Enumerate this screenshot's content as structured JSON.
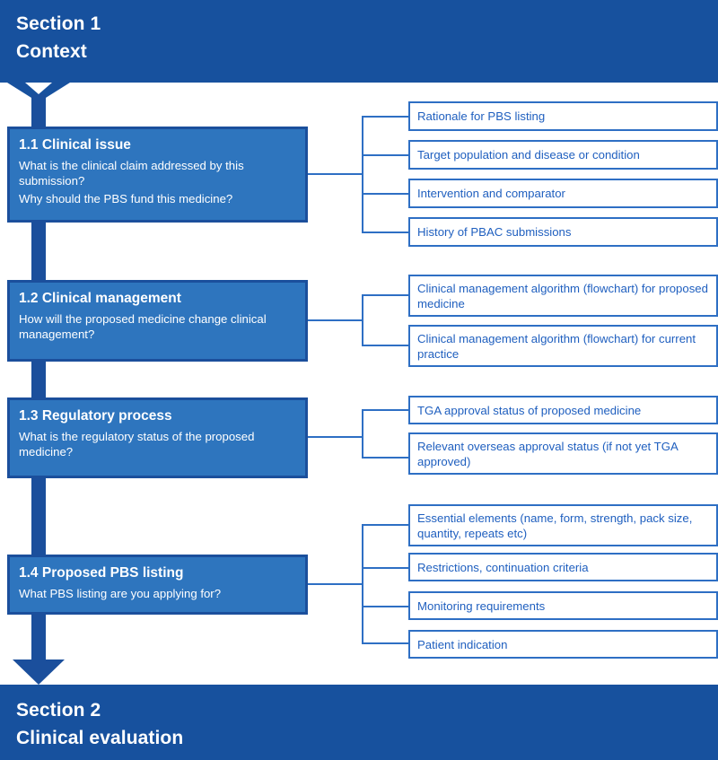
{
  "top_section": {
    "label": "Section 1",
    "name": "Context"
  },
  "bottom_section": {
    "label": "Section 2",
    "name": "Clinical evaluation"
  },
  "groups": [
    {
      "id": "1.1",
      "title": "1.1 Clinical issue",
      "questions": [
        "What is the clinical claim addressed by this submission?",
        "Why should the PBS fund this medicine?"
      ],
      "items": [
        "Rationale for PBS listing",
        "Target population and disease or condition",
        "Intervention and comparator",
        "History of PBAC submissions"
      ]
    },
    {
      "id": "1.2",
      "title": "1.2 Clinical management",
      "questions": [
        "How will the proposed medicine change clinical management?"
      ],
      "items": [
        "Clinical management algorithm (flowchart) for proposed medicine",
        "Clinical management algorithm (flowchart) for current practice"
      ]
    },
    {
      "id": "1.3",
      "title": "1.3 Regulatory process",
      "questions": [
        "What is the regulatory status of the proposed medicine?"
      ],
      "items": [
        "TGA approval status of proposed medicine",
        "Relevant overseas approval status (if not yet TGA approved)"
      ]
    },
    {
      "id": "1.4",
      "title": "1.4 Proposed PBS listing",
      "questions": [
        "What PBS listing are you applying for?"
      ],
      "items": [
        "Essential elements (name, form, strength, pack size, quantity, repeats etc)",
        "Restrictions, continuation criteria",
        "Monitoring requirements",
        "Patient indication"
      ]
    }
  ],
  "colors": {
    "header_bar": "#17519E",
    "primary_box_fill": "#2E75BE",
    "primary_box_border": "#1B4F9C",
    "sub_box_border": "#2E6FC4",
    "sub_box_text": "#1F5FBF",
    "spine": "#1B4F9C",
    "page_background": "#FFFFFF"
  }
}
